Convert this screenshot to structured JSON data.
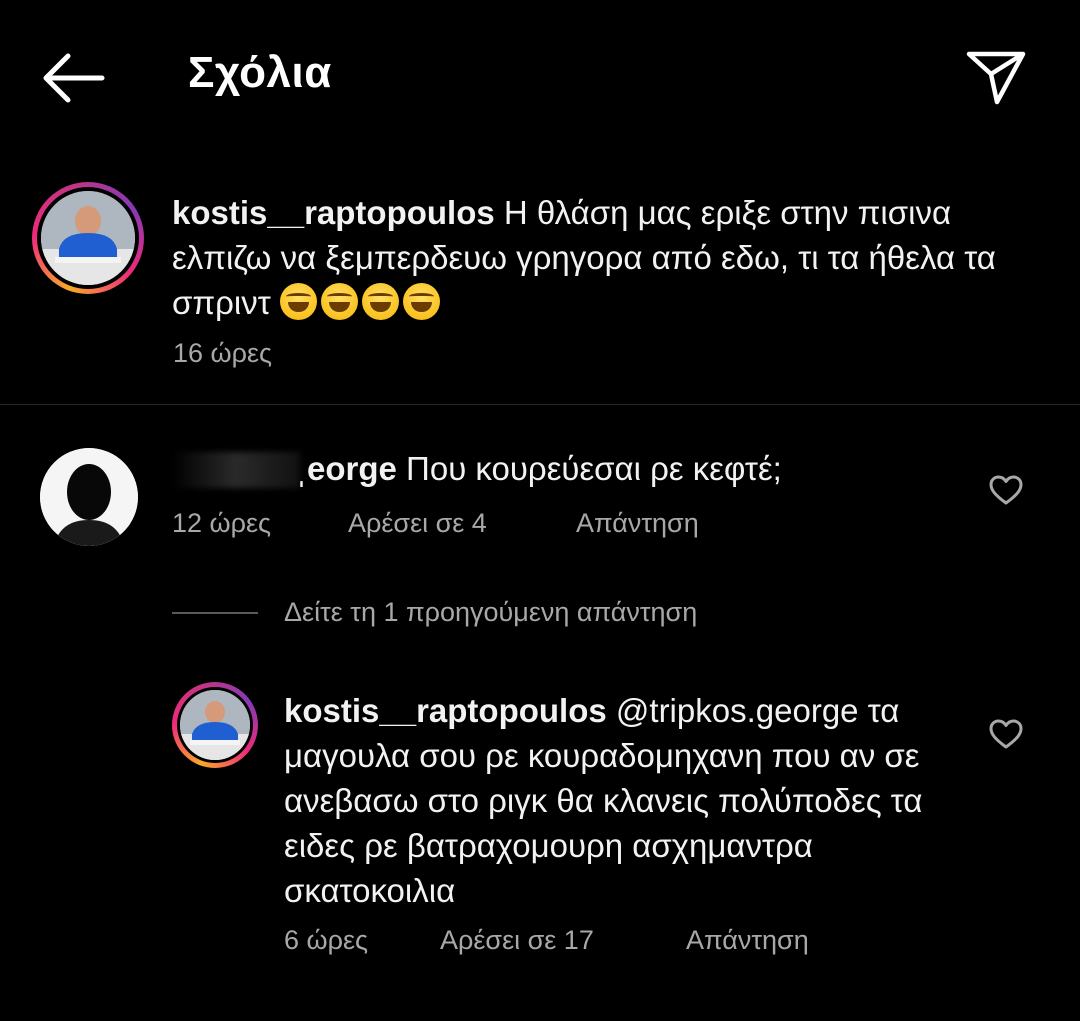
{
  "header": {
    "title": "Σχόλια"
  },
  "caption": {
    "username": "kostis__raptopoulos",
    "text": " Η θλάση μας εριξε στην πισινα ελπιζω να ξεμπερδευω γρηγορα από εδω, τι τα ήθελα τα σπριντ",
    "emoji": [
      "laughing-emoji",
      "laughing-emoji",
      "laughing-emoji",
      "laughing-emoji"
    ],
    "time": "16 ώρες"
  },
  "comments": [
    {
      "username": "ˌeorge",
      "text": " Που κουρεύεσαι ρε κεφτέ;",
      "time": "12 ώρες",
      "likes": "Αρέσει σε 4",
      "reply": "Απάντηση"
    }
  ],
  "view_replies": "Δείτε τη 1 προηγούμενη απάντηση",
  "reply": {
    "username": "kostis__raptopoulos",
    "text": " @tripkos.george τα μαγουλα σου ρε κουραδομηχανη που αν σε ανεβασω στο ριγκ θα κλανεις πολύποδες τα ειδες ρε βατραχομουρη ασχημαντρα σκατοκοιλια",
    "time": "6 ώρες",
    "likes": "Αρέσει σε 17",
    "reply": "Απάντηση"
  },
  "colors": {
    "background": "#000000",
    "text": "#f2f2f2",
    "meta": "#a8a8a8",
    "divider": "#262626"
  }
}
